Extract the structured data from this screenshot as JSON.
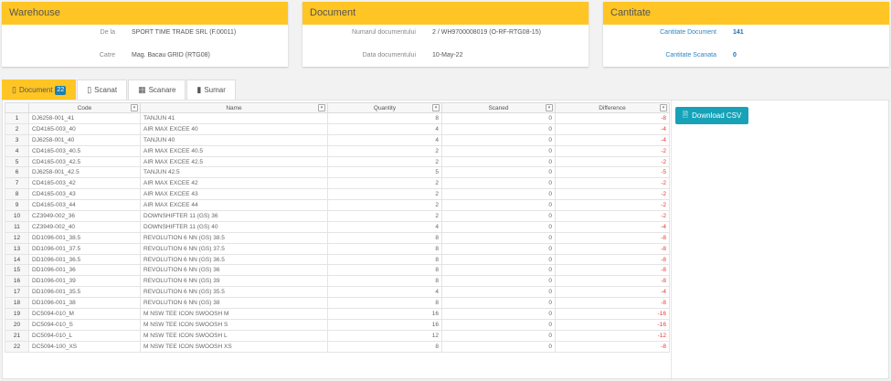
{
  "warehouse": {
    "title": "Warehouse",
    "from_label": "De la",
    "from_value": "SPORT TIME TRADE SRL (F.00011)",
    "to_label": "Catre",
    "to_value": "Mag. Bacau GRID (RTG08)"
  },
  "document": {
    "title": "Document",
    "number_label": "Numarul documentului",
    "number_value": "2 / WH9700008019 (O-RF-RTG08-15)",
    "date_label": "Data documentului",
    "date_value": "10-May-22"
  },
  "quantity": {
    "title": "Cantitate",
    "doc_label": "Cantitate Document",
    "doc_value": "141",
    "scanned_label": "Cantitate Scanata",
    "scanned_value": "0"
  },
  "tabs": [
    {
      "label": "Document",
      "badge": "22",
      "icon": "bookmark-icon"
    },
    {
      "label": "Scanat",
      "icon": "bookmark-outline-icon"
    },
    {
      "label": "Scanare",
      "icon": "barcode-scan-icon"
    },
    {
      "label": "Sumar",
      "icon": "book-icon"
    }
  ],
  "download_label": "Download CSV",
  "columns": [
    "Code",
    "Name",
    "Quantity",
    "Scaned",
    "Difference"
  ],
  "rows": [
    [
      "1",
      "DJ6258-001_41",
      "TANJUN 41",
      "8",
      "0",
      "-8"
    ],
    [
      "2",
      "CD4165-003_40",
      "AIR MAX EXCEE 40",
      "4",
      "0",
      "-4"
    ],
    [
      "3",
      "DJ6258-001_40",
      "TANJUN 40",
      "4",
      "0",
      "-4"
    ],
    [
      "4",
      "CD4165-003_40.5",
      "AIR MAX EXCEE 40.5",
      "2",
      "0",
      "-2"
    ],
    [
      "5",
      "CD4165-003_42.5",
      "AIR MAX EXCEE 42.5",
      "2",
      "0",
      "-2"
    ],
    [
      "6",
      "DJ6258-001_42.5",
      "TANJUN 42.5",
      "5",
      "0",
      "-5"
    ],
    [
      "7",
      "CD4165-003_42",
      "AIR MAX EXCEE 42",
      "2",
      "0",
      "-2"
    ],
    [
      "8",
      "CD4165-003_43",
      "AIR MAX EXCEE 43",
      "2",
      "0",
      "-2"
    ],
    [
      "9",
      "CD4165-003_44",
      "AIR MAX EXCEE 44",
      "2",
      "0",
      "-2"
    ],
    [
      "10",
      "CZ3949-002_36",
      "DOWNSHIFTER 11 (GS) 36",
      "2",
      "0",
      "-2"
    ],
    [
      "11",
      "CZ3949-002_40",
      "DOWNSHIFTER 11 (GS) 40",
      "4",
      "0",
      "-4"
    ],
    [
      "12",
      "DD1096-001_38.5",
      "REVOLUTION 6 NN (GS) 38.5",
      "8",
      "0",
      "-8"
    ],
    [
      "13",
      "DD1096-001_37.5",
      "REVOLUTION 6 NN (GS) 37.5",
      "8",
      "0",
      "-8"
    ],
    [
      "14",
      "DD1096-001_36.5",
      "REVOLUTION 6 NN (GS) 36.5",
      "8",
      "0",
      "-8"
    ],
    [
      "15",
      "DD1096-001_36",
      "REVOLUTION 6 NN (GS) 36",
      "8",
      "0",
      "-8"
    ],
    [
      "16",
      "DD1096-001_39",
      "REVOLUTION 6 NN (GS) 39",
      "8",
      "0",
      "-8"
    ],
    [
      "17",
      "DD1096-001_35.5",
      "REVOLUTION 6 NN (GS) 35.5",
      "4",
      "0",
      "-4"
    ],
    [
      "18",
      "DD1096-001_38",
      "REVOLUTION 6 NN (GS) 38",
      "8",
      "0",
      "-8"
    ],
    [
      "19",
      "DC5094-010_M",
      "M NSW TEE ICON SWOOSH M",
      "16",
      "0",
      "-16"
    ],
    [
      "20",
      "DC5094-010_S",
      "M NSW TEE ICON SWOOSH S",
      "16",
      "0",
      "-16"
    ],
    [
      "21",
      "DC5094-010_L",
      "M NSW TEE ICON SWOOSH L",
      "12",
      "0",
      "-12"
    ],
    [
      "22",
      "DC5094-100_XS",
      "M NSW TEE ICON SWOOSH XS",
      "8",
      "0",
      "-8"
    ]
  ]
}
